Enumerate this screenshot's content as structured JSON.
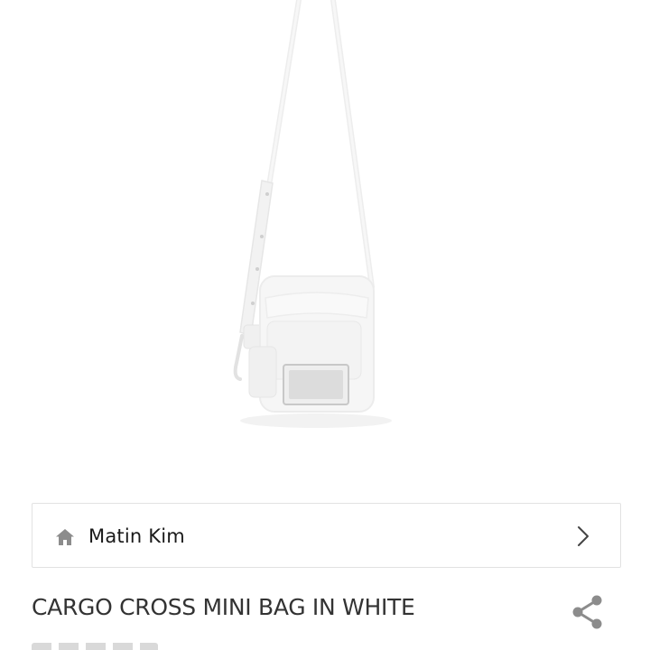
{
  "product": {
    "image_alt": "white cargo cross mini bag",
    "brand": {
      "icon": "home-icon",
      "name": "Matin Kim",
      "chevron": "chevron-right-icon"
    },
    "title": "CARGO CROSS MINI BAG IN WHITE",
    "share_icon": "share-icon"
  },
  "colors": {
    "text_primary": "#1a1a1a",
    "text_title": "#333333",
    "icon": "#8c8c8c",
    "border": "#e2e2e2",
    "bag": "#f6f6f6"
  }
}
